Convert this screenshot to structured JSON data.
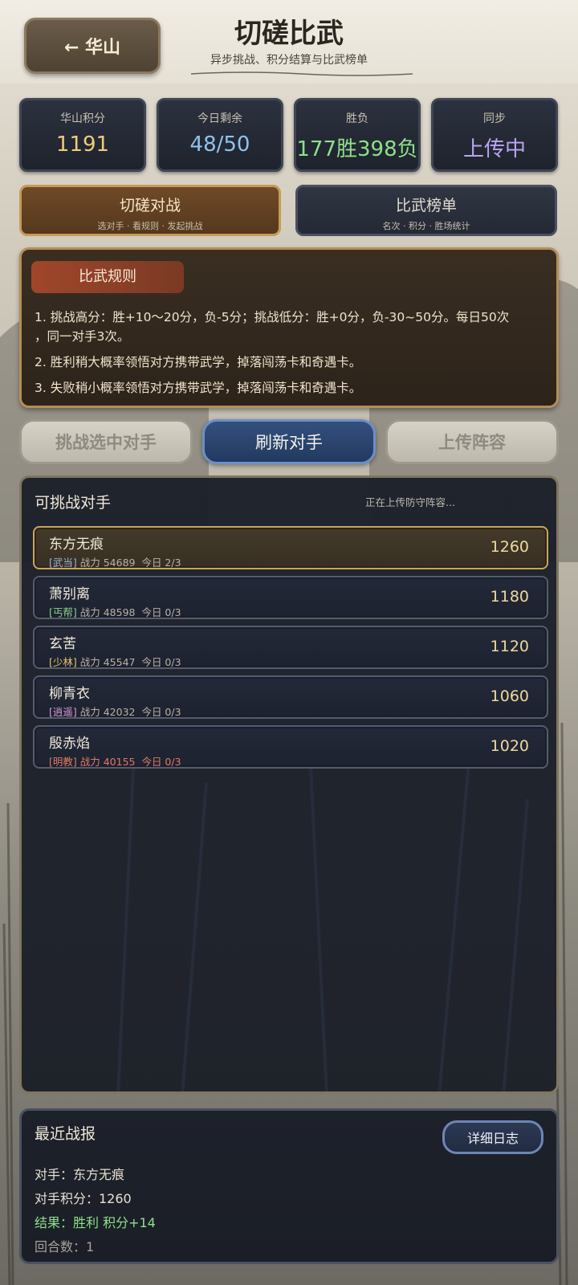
{
  "header": {
    "back_label": "← 华山",
    "title": "切磋比武",
    "subtitle": "异步挑战、积分结算与比武榜单"
  },
  "stats": [
    {
      "label": "华山积分",
      "value": "1191",
      "color": "#f0cc7a"
    },
    {
      "label": "今日剩余",
      "value": "48/50",
      "color": "#8ec3ea"
    },
    {
      "label": "胜负",
      "value": "177胜398负",
      "color": "#8ee08c"
    },
    {
      "label": "同步",
      "value": "上传中",
      "color": "#b9a6f2"
    }
  ],
  "modes": [
    {
      "title": "切磋对战",
      "sub": "选对手 · 看规则 · 发起挑战",
      "active": true
    },
    {
      "title": "比武榜单",
      "sub": "名次 · 积分 · 胜场统计",
      "active": false
    }
  ],
  "rules": {
    "tag": "比武规则",
    "line1a": "1. 挑战高分：胜+10～20分，负-5分；挑战低分：胜+0分，负-30~50分。每日50次",
    "line1b": "，同一对手3次。",
    "line2": "2. 胜利稍大概率领悟对方携带武学，掉落闯荡卡和奇遇卡。",
    "line3": "3. 失败稍小概率领悟对方携带武学，掉落闯荡卡和奇遇卡。"
  },
  "actions": {
    "challenge": "挑战选中对手",
    "refresh": "刷新对手",
    "upload": "上传阵容"
  },
  "opponents_panel": {
    "title": "可挑战对手",
    "status": "正在上传防守阵容...",
    "items": [
      {
        "name": "东方无痕",
        "sect": "[武当]",
        "power": "战力 54689",
        "today": "今日 2/3",
        "score": "1260",
        "sect_color": "#9bb0d8",
        "selected": true
      },
      {
        "name": "萧别离",
        "sect": "[丐帮]",
        "power": "战力 48598",
        "today": "今日 0/3",
        "score": "1180",
        "sect_color": "#8ed08a",
        "selected": false
      },
      {
        "name": "玄苦",
        "sect": "[少林]",
        "power": "战力 45547",
        "today": "今日 0/3",
        "score": "1120",
        "sect_color": "#e6c46a",
        "selected": false
      },
      {
        "name": "柳青衣",
        "sect": "[逍遥]",
        "power": "战力 42032",
        "today": "今日 0/3",
        "score": "1060",
        "sect_color": "#d69ad6",
        "selected": false
      },
      {
        "name": "殷赤焰",
        "sect": "[明教]",
        "power": "战力 40155",
        "today": "今日 0/3",
        "score": "1020",
        "sect_color": "#e07a62",
        "selected": false
      }
    ]
  },
  "report": {
    "title": "最近战报",
    "log_button": "详细日志",
    "opponent": "对手：东方无痕",
    "opponent_score": "对手积分：1260",
    "result": "结果：胜利  积分+14",
    "rounds": "回合数：1"
  }
}
